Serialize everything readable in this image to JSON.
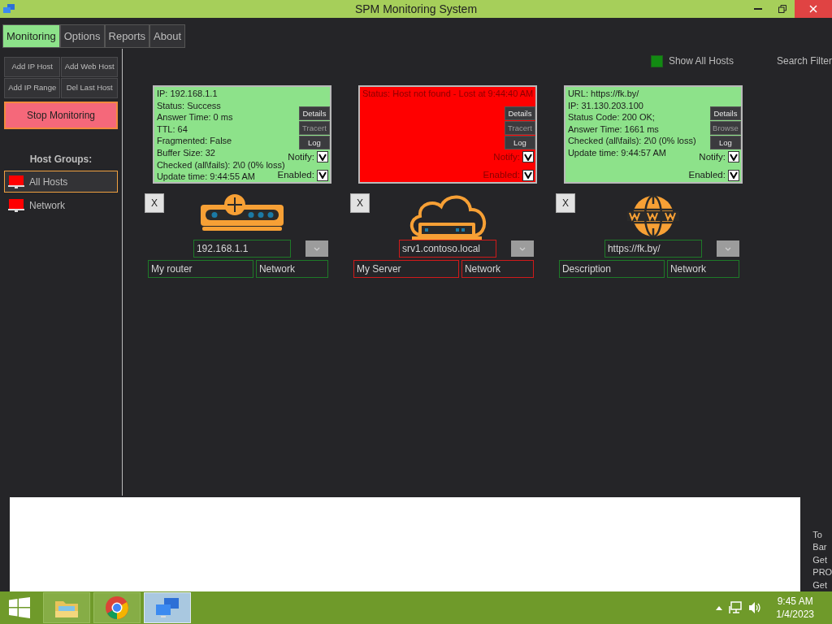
{
  "window": {
    "title": "SPM Monitoring System"
  },
  "tabs": [
    {
      "label": "Monitoring",
      "selected": true
    },
    {
      "label": "Options",
      "selected": false
    },
    {
      "label": "Reports",
      "selected": false
    },
    {
      "label": "About",
      "selected": false
    }
  ],
  "actions": [
    "Add IP Host",
    "Add Web Host",
    "Add IP Range",
    "Del Last Host"
  ],
  "stop_button": "Stop Monitoring",
  "host_groups": {
    "title": "Host Groups:",
    "items": [
      {
        "label": "All Hosts",
        "selected": true
      },
      {
        "label": "Network",
        "selected": false
      }
    ]
  },
  "show_all_hosts": {
    "label": "Show All Hosts",
    "checked": true
  },
  "search_filter": {
    "label": "Search Filter"
  },
  "hosts": [
    {
      "kind": "router",
      "failed": false,
      "lines": [
        "IP: 192.168.1.1",
        "Status: Success",
        "Answer Time: 0 ms",
        "TTL: 64",
        "Fragmented: False",
        "Buffer Size: 32",
        "Checked (all\\fails): 2\\0 (0% loss)",
        "Update time: 9:44:55 AM"
      ],
      "buttons": [
        {
          "label": "Details",
          "disabled": false
        },
        {
          "label": "Tracert",
          "disabled": true
        },
        {
          "label": "Log",
          "disabled": false
        }
      ],
      "notify": {
        "label": "Notify:",
        "checked": true
      },
      "enabled": {
        "label": "Enabled:",
        "checked": true
      },
      "remove": "X",
      "address": "192.168.1.1",
      "description": "My router",
      "group": "Network"
    },
    {
      "kind": "server",
      "failed": true,
      "lines": [
        "Status: Host not found - Lost at 9:44:40 AM"
      ],
      "buttons": [
        {
          "label": "Details",
          "disabled": false
        },
        {
          "label": "Tracert",
          "disabled": true
        },
        {
          "label": "Log",
          "disabled": false
        }
      ],
      "notify": {
        "label": "Notify:",
        "checked": true
      },
      "enabled": {
        "label": "Enabled:",
        "checked": true
      },
      "remove": "X",
      "address": "srv1.contoso.local",
      "description": "My Server",
      "group": "Network"
    },
    {
      "kind": "web",
      "failed": false,
      "lines": [
        "URL: https://fk.by/",
        "IP: 31.130.203.100",
        "Status Code: 200 OK;",
        "Answer Time: 1661 ms",
        "Checked (all\\fails): 2\\0 (0% loss)",
        "Update time: 9:44:57 AM"
      ],
      "buttons": [
        {
          "label": "Details",
          "disabled": false
        },
        {
          "label": "Browse",
          "disabled": true
        },
        {
          "label": "Log",
          "disabled": false
        }
      ],
      "notify": {
        "label": "Notify:",
        "checked": true
      },
      "enabled": {
        "label": "Enabled:",
        "checked": true
      },
      "remove": "X",
      "address": "https://fk.by/",
      "description": "Description",
      "group": "Network"
    }
  ],
  "side_text": [
    "To",
    "Bar",
    "Get",
    "PRO",
    "Get"
  ],
  "taskbar": {
    "apps": [
      {
        "kind": "folder",
        "selected": false
      },
      {
        "kind": "browser",
        "selected": false
      },
      {
        "kind": "monitor",
        "selected": true
      }
    ],
    "time": "9:45 AM",
    "date": "1/4/2023"
  }
}
